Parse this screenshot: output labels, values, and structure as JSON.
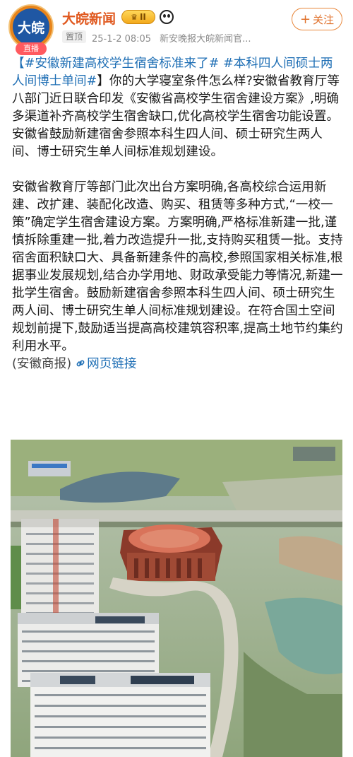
{
  "header": {
    "avatar_text": "大皖",
    "live_label": "直播",
    "account_name": "大皖新闻",
    "vip_level": "II",
    "follow_label": "关注",
    "pin_label": "置顶",
    "timestamp": "25-1-2 08:05",
    "source": "新安晚报大皖新闻官..."
  },
  "post": {
    "hashtag1": "【#安徽新建高校学生宿舍标准来了#",
    "hashtag2": "#本科四人间硕士两人间博士单间#",
    "para1_rest": "】你的大学寝室条件怎么样?安徽省教育厅等八部门近日联合印发《安徽省高校学生宿舍建设方案》,明确多渠道补齐高校学生宿舍缺口,优化高校学生宿舍功能设置。安徽省鼓励新建宿舍参照本科生四人间、硕士研究生两人间、博士研究生单人间标准规划建设。",
    "para2": "安徽省教育厅等部门此次出台方案明确,各高校综合运用新建、改扩建、装配化改造、购买、租赁等多种方式,“一校一策”确定学生宿舍建设方案。方案明确,严格标准新建一批,谨慎拆除重建一批,着力改造提升一批,支持购买租赁一批。支持宿舍面积缺口大、具备新建条件的高校,参照国家相关标准,根据事业发展规划,结合办学用地、财政承受能力等情况,新建一批学生宿舍。鼓励新建宿舍参照本科生四人间、硕士研究生两人间、博士研究生单人间标准规划建设。在符合国土空间规划前提下,鼓励适当提高高校建筑容积率,提高土地节约集约利用水平。",
    "source_note": "(安徽商报)",
    "web_link_label": "网页链接"
  },
  "colors": {
    "accent_orange": "#e0581e",
    "link_blue": "#1f6fb5"
  }
}
